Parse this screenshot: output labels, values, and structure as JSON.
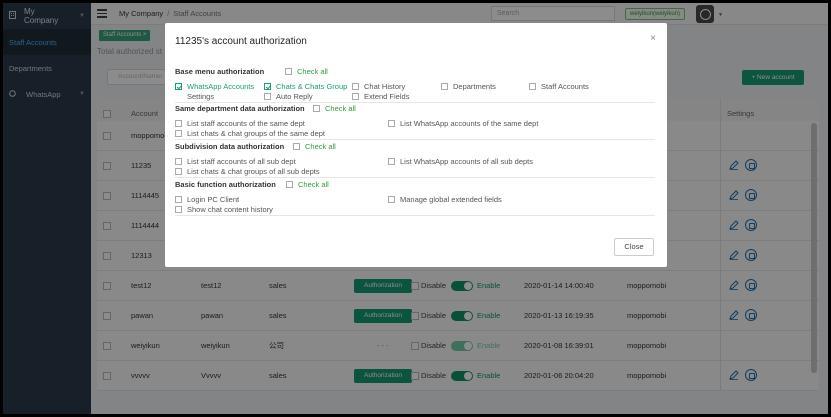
{
  "sidebar": {
    "company": "My Company",
    "items": [
      {
        "label": "Staff Accounts",
        "active": true
      },
      {
        "label": "Departments",
        "active": false
      },
      {
        "label": "WhatsApp",
        "active": false
      }
    ]
  },
  "header": {
    "breadcrumb_root": "My Company",
    "breadcrumb_sep": "/",
    "breadcrumb_page": "Staff Accounts",
    "search_placeholder": "Search",
    "user_badge": "weiyikun(weiyikun)"
  },
  "tab": {
    "label": "Staff Accounts ×"
  },
  "total_label": "Total authorized st",
  "account_input_placeholder": "Account/Name/",
  "new_account_label": "+ New account",
  "table": {
    "headers": {
      "account": "Account",
      "settings": "Settings"
    },
    "rows": [
      {
        "account": "moppomobi",
        "name": "",
        "dept": "",
        "auth": "",
        "disable": "",
        "enable": "",
        "date": "",
        "creator": ""
      },
      {
        "account": "11235",
        "name": "",
        "dept": "",
        "auth": "",
        "disable": "",
        "enable": "",
        "date": "",
        "creator": ""
      },
      {
        "account": "1114445",
        "name": "",
        "dept": "",
        "auth": "",
        "disable": "",
        "enable": "",
        "date": "",
        "creator": ""
      },
      {
        "account": "1114444",
        "name": "",
        "dept": "",
        "auth": "",
        "disable": "",
        "enable": "",
        "date": "",
        "creator": ""
      },
      {
        "account": "12313",
        "name": "",
        "dept": "",
        "auth": "",
        "disable": "",
        "enable": "",
        "date": "",
        "creator": ""
      },
      {
        "account": "test12",
        "name": "test12",
        "dept": "sales",
        "auth": "Authorization",
        "disable": "Disable",
        "enable": "Enable",
        "date": "2020-01-14 14:00:40",
        "creator": "moppomobi"
      },
      {
        "account": "pawan",
        "name": "pawan",
        "dept": "sales",
        "auth": "Authorization",
        "disable": "Disable",
        "enable": "Enable",
        "date": "2020-01-13 16:19:35",
        "creator": "moppomobi"
      },
      {
        "account": "weiyikun",
        "name": "weiyikun",
        "dept": "公司",
        "auth": "- - -",
        "disable": "Disable",
        "enable": "Enable",
        "date": "2020-01-08 16:39:01",
        "creator": "moppomobi"
      },
      {
        "account": "vvvvv",
        "name": "Vvvvv",
        "dept": "sales",
        "auth": "Authorization",
        "disable": "Disable",
        "enable": "Enable",
        "date": "2020-01-06 20:04:20",
        "creator": "moppomobi"
      }
    ]
  },
  "modal": {
    "title": "11235's account authorization",
    "close_x": "×",
    "sections": [
      {
        "title": "Base menu authorization",
        "check_all": "Check all",
        "options": [
          "WhatsApp Accounts",
          "Chats & Chats Group",
          "Chat History",
          "Departments",
          "Staff Accounts",
          "Settings",
          "Auto Reply",
          "Extend Fields"
        ]
      },
      {
        "title": "Same department data authorization",
        "check_all": "Check all",
        "options": [
          "List staff accounts of the same dept",
          "List WhatsApp accounts of the same dept",
          "List chats & chat groups of the same dept"
        ]
      },
      {
        "title": "Subdivision data authorization",
        "check_all": "Check all",
        "options": [
          "List staff accounts of all sub dept",
          "List WhatsApp accounts of all sub depts",
          "List chats & chat groups of all sub depts"
        ]
      },
      {
        "title": "Basic function authorization",
        "check_all": "Check all",
        "options": [
          "Login PC Client",
          "Manage global extended fields",
          "Show chat content history"
        ]
      }
    ],
    "close_button": "Close"
  },
  "colors": {
    "accent": "#1a9c76",
    "sidebar": "#2b3a4a",
    "active_link": "#4fb3ff"
  }
}
